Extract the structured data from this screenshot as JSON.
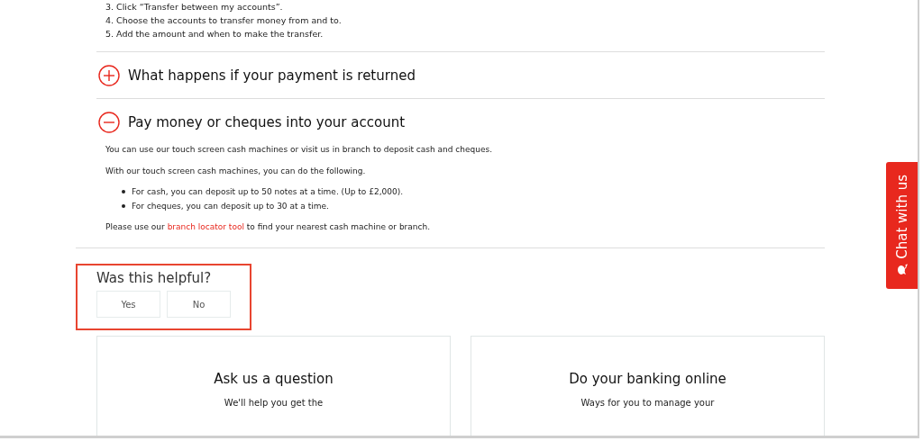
{
  "steps": [
    "3. Click “Transfer between my accounts”.",
    "4. Choose the accounts to transfer money from and to.",
    "5. Add the amount and when to make the transfer."
  ],
  "accordion": [
    {
      "title": "What happens if your payment is returned",
      "expanded": false
    },
    {
      "title": "Pay money or cheques into your account",
      "expanded": true,
      "paragraphs": [
        "You can use our touch screen cash machines or visit us in branch to deposit cash and cheques.",
        "With our touch screen cash machines, you can do the following."
      ],
      "bullets": [
        "For cash, you can deposit up to 50 notes at a time. (Up to £2,000).",
        "For cheques, you can deposit up to 30 at a time."
      ],
      "closing": {
        "before": "Please use our ",
        "link": "branch locator tool",
        "after": " to find your nearest cash machine or branch."
      }
    }
  ],
  "feedback": {
    "question": "Was this helpful?",
    "buttons": [
      "Yes",
      "No"
    ],
    "highlighted": true
  },
  "cards": [
    {
      "title": "Ask us a question",
      "text": "We'll help you get the"
    },
    {
      "title": "Do your banking online",
      "text": "Ways for you to manage your"
    }
  ],
  "chat_tab": {
    "label": "Chat with us"
  }
}
